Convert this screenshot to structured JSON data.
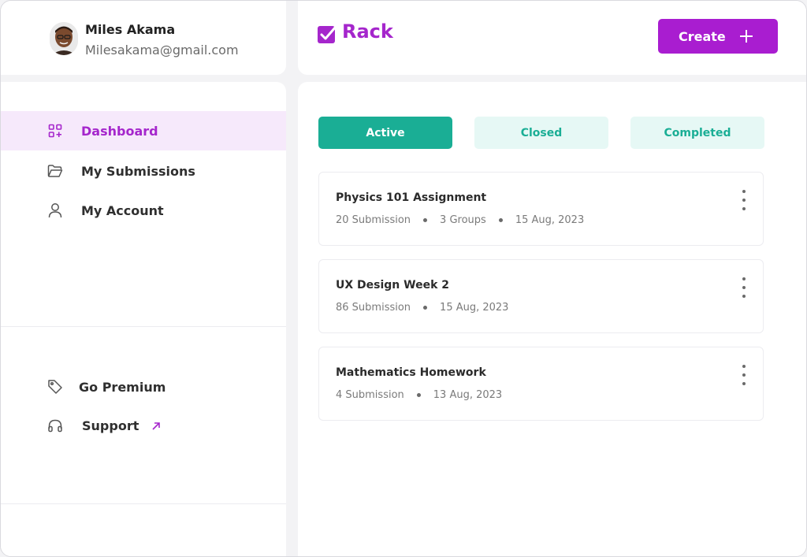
{
  "profile": {
    "name": "Miles Akama",
    "email": "Milesakama@gmail.com"
  },
  "sidebar": {
    "items": [
      {
        "label": "Dashboard",
        "icon": "dashboard-icon",
        "active": true
      },
      {
        "label": "My Submissions",
        "icon": "folder-icon",
        "active": false
      },
      {
        "label": "My Account",
        "icon": "user-icon",
        "active": false
      }
    ],
    "bottom": [
      {
        "label": "Go Premium",
        "icon": "tag-icon"
      },
      {
        "label": "Support",
        "icon": "headphones-icon"
      }
    ]
  },
  "header": {
    "brand": "Rack",
    "create_label": "Create"
  },
  "tabs": [
    {
      "label": "Active",
      "active": true
    },
    {
      "label": "Closed",
      "active": false
    },
    {
      "label": "Completed",
      "active": false
    }
  ],
  "cards": [
    {
      "title": "Physics 101 Assignment",
      "submissions": "20 Submission",
      "groups": "3 Groups",
      "date": "15 Aug, 2023"
    },
    {
      "title": "UX Design Week 2",
      "submissions": "86 Submission",
      "date": "15 Aug, 2023"
    },
    {
      "title": "Mathematics Homework",
      "submissions": "4 Submission",
      "date": "13 Aug, 2023"
    }
  ],
  "colors": {
    "brand": "#a526cc",
    "accent_green": "#1aae95",
    "active_nav_bg": "#f6e9fb"
  }
}
